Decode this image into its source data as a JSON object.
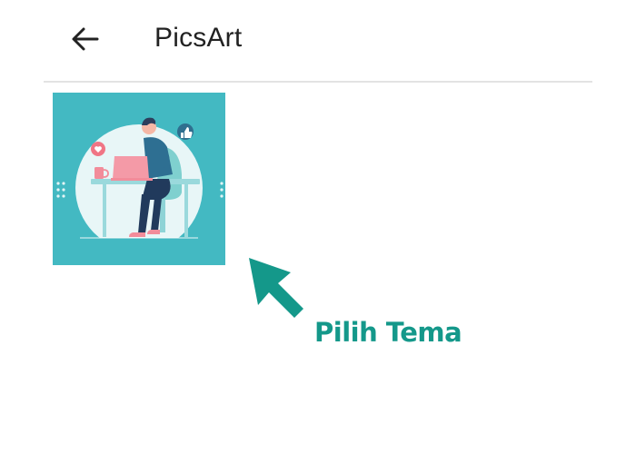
{
  "header": {
    "back_icon": "arrow-left-icon",
    "title": "PicsArt"
  },
  "content": {
    "theme_thumbnail": {
      "illustration": "person-working-on-laptop-illustration",
      "background_color": "#42b9c3",
      "icons": [
        "heart-icon",
        "thumbs-up-icon"
      ]
    }
  },
  "annotation": {
    "arrow_icon": "pointer-arrow-icon",
    "label": "Pilih Tema",
    "color": "#14988a"
  },
  "colors": {
    "title_text": "#222222",
    "divider": "#e3e3e3",
    "accent": "#14988a"
  }
}
